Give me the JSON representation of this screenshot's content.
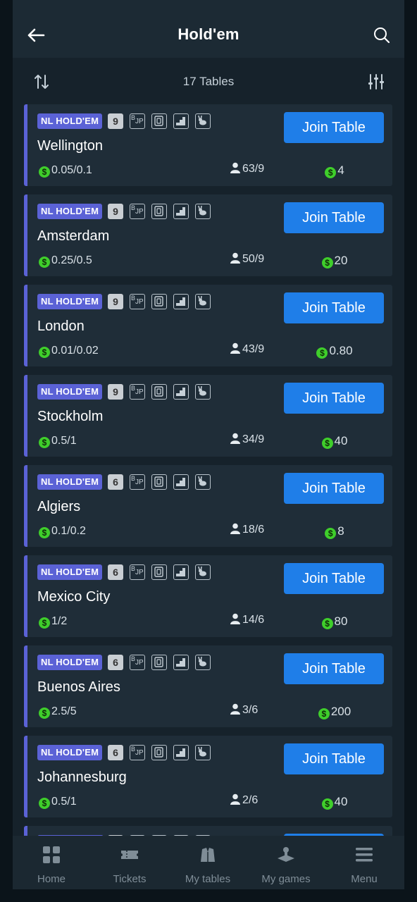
{
  "header": {
    "title": "Hold'em",
    "back_icon": "arrow-left-icon",
    "search_icon": "search-icon"
  },
  "listbar": {
    "count_text": "17 Tables",
    "sort_icon": "sort-icon",
    "filter_icon": "filter-sliders-icon"
  },
  "colors": {
    "accent": "#5b62d6",
    "join_button": "#1f7ee8",
    "coin": "#3fce2b",
    "background": "#16222b",
    "card": "#1f2d38"
  },
  "tables": [
    {
      "game": "NL HOLD'EM",
      "seats": "9",
      "name": "Wellington",
      "stakes": "0.05/0.1",
      "players": "63/9",
      "buyin": "4",
      "join_label": "Join Table"
    },
    {
      "game": "NL HOLD'EM",
      "seats": "9",
      "name": "Amsterdam",
      "stakes": "0.25/0.5",
      "players": "50/9",
      "buyin": "20",
      "join_label": "Join Table"
    },
    {
      "game": "NL HOLD'EM",
      "seats": "9",
      "name": "London",
      "stakes": "0.01/0.02",
      "players": "43/9",
      "buyin": "0.80",
      "join_label": "Join Table"
    },
    {
      "game": "NL HOLD'EM",
      "seats": "9",
      "name": "Stockholm",
      "stakes": "0.5/1",
      "players": "34/9",
      "buyin": "40",
      "join_label": "Join Table"
    },
    {
      "game": "NL HOLD'EM",
      "seats": "6",
      "name": "Algiers",
      "stakes": "0.1/0.2",
      "players": "18/6",
      "buyin": "8",
      "join_label": "Join Table"
    },
    {
      "game": "NL HOLD'EM",
      "seats": "6",
      "name": "Mexico City",
      "stakes": "1/2",
      "players": "14/6",
      "buyin": "80",
      "join_label": "Join Table"
    },
    {
      "game": "NL HOLD'EM",
      "seats": "6",
      "name": "Buenos Aires",
      "stakes": "2.5/5",
      "players": "3/6",
      "buyin": "200",
      "join_label": "Join Table"
    },
    {
      "game": "NL HOLD'EM",
      "seats": "6",
      "name": "Johannesburg",
      "stakes": "0.5/1",
      "players": "2/6",
      "buyin": "40",
      "join_label": "Join Table"
    }
  ],
  "feature_icons": [
    "bad-beat-jackpot-icon",
    "cards-icon",
    "stairs-icon",
    "rabbit-hunt-icon"
  ],
  "coin_symbol": "$",
  "tabbar": [
    {
      "label": "Home",
      "icon": "home-grid-icon"
    },
    {
      "label": "Tickets",
      "icon": "ticket-icon"
    },
    {
      "label": "My tables",
      "icon": "my-tables-icon"
    },
    {
      "label": "My games",
      "icon": "my-games-icon"
    },
    {
      "label": "Menu",
      "icon": "menu-icon"
    }
  ]
}
